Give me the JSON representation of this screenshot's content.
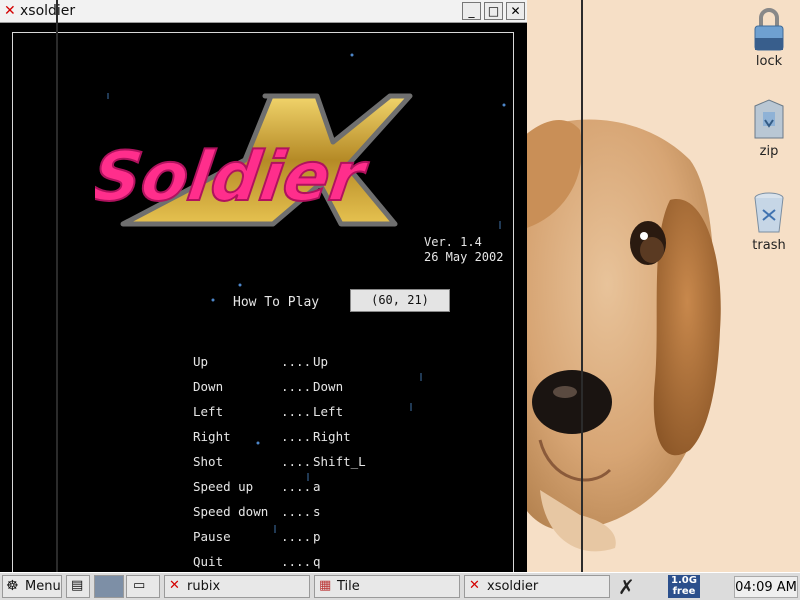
{
  "window": {
    "title": "xsoldier",
    "buttons": {
      "minimize": "_",
      "maximize": "□",
      "close": "✕"
    }
  },
  "game": {
    "logo_text": "Soldier",
    "logo_letter": "X",
    "version_line1": "Ver. 1.4",
    "version_line2": "26 May 2002",
    "how_to_play_label": "How To Play",
    "how_to_play_value": "(60, 21)",
    "controls": [
      {
        "action": "Up",
        "dots": "....",
        "key": "Up"
      },
      {
        "action": "Down",
        "dots": "....",
        "key": "Down"
      },
      {
        "action": "Left",
        "dots": "....",
        "key": "Left"
      },
      {
        "action": "Right",
        "dots": "....",
        "key": "Right"
      },
      {
        "action": "Shot",
        "dots": "....",
        "key": "Shift_L"
      },
      {
        "action": "Speed up",
        "dots": "....",
        "key": "a"
      },
      {
        "action": "Speed down",
        "dots": "....",
        "key": "s"
      },
      {
        "action": "Pause",
        "dots": "....",
        "key": "p"
      },
      {
        "action": "Quit",
        "dots": "....",
        "key": "q"
      }
    ],
    "colors": {
      "logo_pink": "#ff2e8c",
      "logo_gold": "#c8a23a",
      "text": "#e6e6e6"
    }
  },
  "desktop": {
    "icons": [
      {
        "label": "lock",
        "icon": "padlock-icon"
      },
      {
        "label": "zip",
        "icon": "zip-archive-icon"
      },
      {
        "label": "trash",
        "icon": "trash-can-icon"
      }
    ]
  },
  "taskbar": {
    "menu_label": "Menu",
    "tasks": [
      {
        "label": "rubix",
        "icon": "x-app-icon"
      },
      {
        "label": "Tile",
        "icon": "tile-icon"
      },
      {
        "label": "xsoldier",
        "icon": "x-app-icon"
      }
    ],
    "memory_line1": "1.0G",
    "memory_line2": "free",
    "clock": "04:09 AM"
  }
}
